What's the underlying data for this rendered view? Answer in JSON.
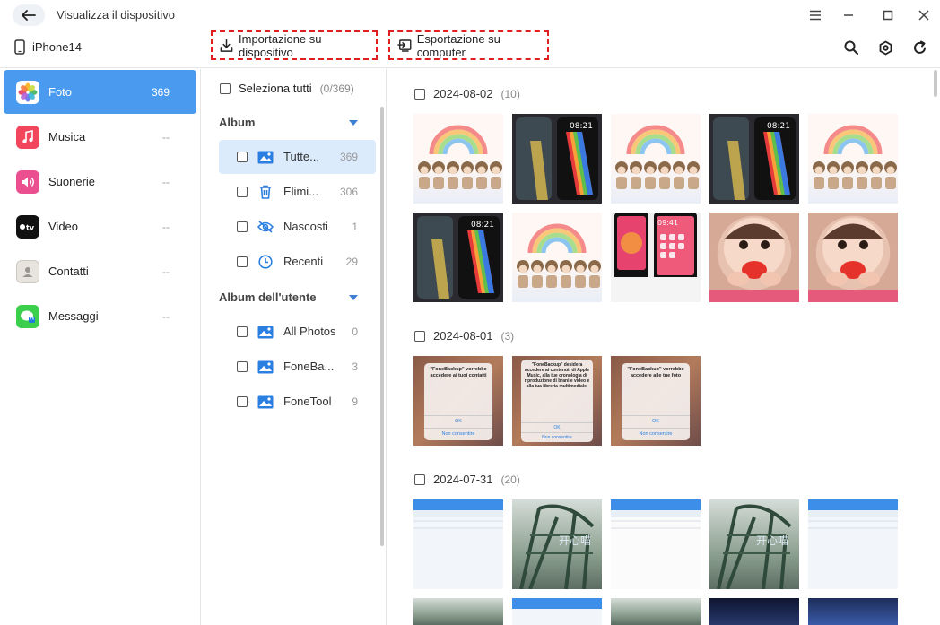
{
  "window": {
    "title": "Visualizza il dispositivo"
  },
  "device": {
    "name": "iPhone14"
  },
  "toolbar": {
    "import_label": "Importazione su dispositivo",
    "export_label": "Esportazione su computer"
  },
  "nav": {
    "items": [
      {
        "label": "Foto",
        "count": "369",
        "icon": "photos-icon"
      },
      {
        "label": "Musica",
        "count": "--",
        "icon": "music-icon"
      },
      {
        "label": "Suonerie",
        "count": "--",
        "icon": "ringtone-icon"
      },
      {
        "label": "Video",
        "count": "--",
        "icon": "appletv-icon"
      },
      {
        "label": "Contatti",
        "count": "--",
        "icon": "contacts-icon"
      },
      {
        "label": "Messaggi",
        "count": "--",
        "icon": "messages-icon"
      }
    ]
  },
  "albums": {
    "select_all": "Seleziona tutti",
    "select_count": "(0/369)",
    "album_header": "Album",
    "user_header": "Album dell'utente",
    "system": [
      {
        "name": "Tutte...",
        "count": "369",
        "icon": "image-icon"
      },
      {
        "name": "Elimi...",
        "count": "306",
        "icon": "trash-icon"
      },
      {
        "name": "Nascosti",
        "count": "1",
        "icon": "eye-off-icon"
      },
      {
        "name": "Recenti",
        "count": "29",
        "icon": "clock-icon"
      }
    ],
    "user": [
      {
        "name": "All Photos",
        "count": "0",
        "icon": "image-icon"
      },
      {
        "name": "FoneBa...",
        "count": "3",
        "icon": "image-icon"
      },
      {
        "name": "FoneTool",
        "count": "9",
        "icon": "image-icon"
      }
    ]
  },
  "groups": [
    {
      "date": "2024-08-02",
      "count": "(10)"
    },
    {
      "date": "2024-08-01",
      "count": "(3)"
    },
    {
      "date": "2024-07-31",
      "count": "(20)"
    }
  ],
  "thumbs": {
    "g1_time": "08:21",
    "g1_time2": "09:41",
    "dialog1_title": "\"FoneBackup\" vorrebbe accedere ai tuoi contatti",
    "dialog2_title": "\"FoneBackup\" desidera accedere ai contenuti di Apple Music, alla tue cronologia di riproduzione di brani e video e alla tua libreria multimediale.",
    "dialog3_title": "\"FoneBackup\" vorrebbe accedere alle tue foto",
    "ok": "OK",
    "deny": "Non consentire",
    "coaster_text": "开心喵"
  }
}
